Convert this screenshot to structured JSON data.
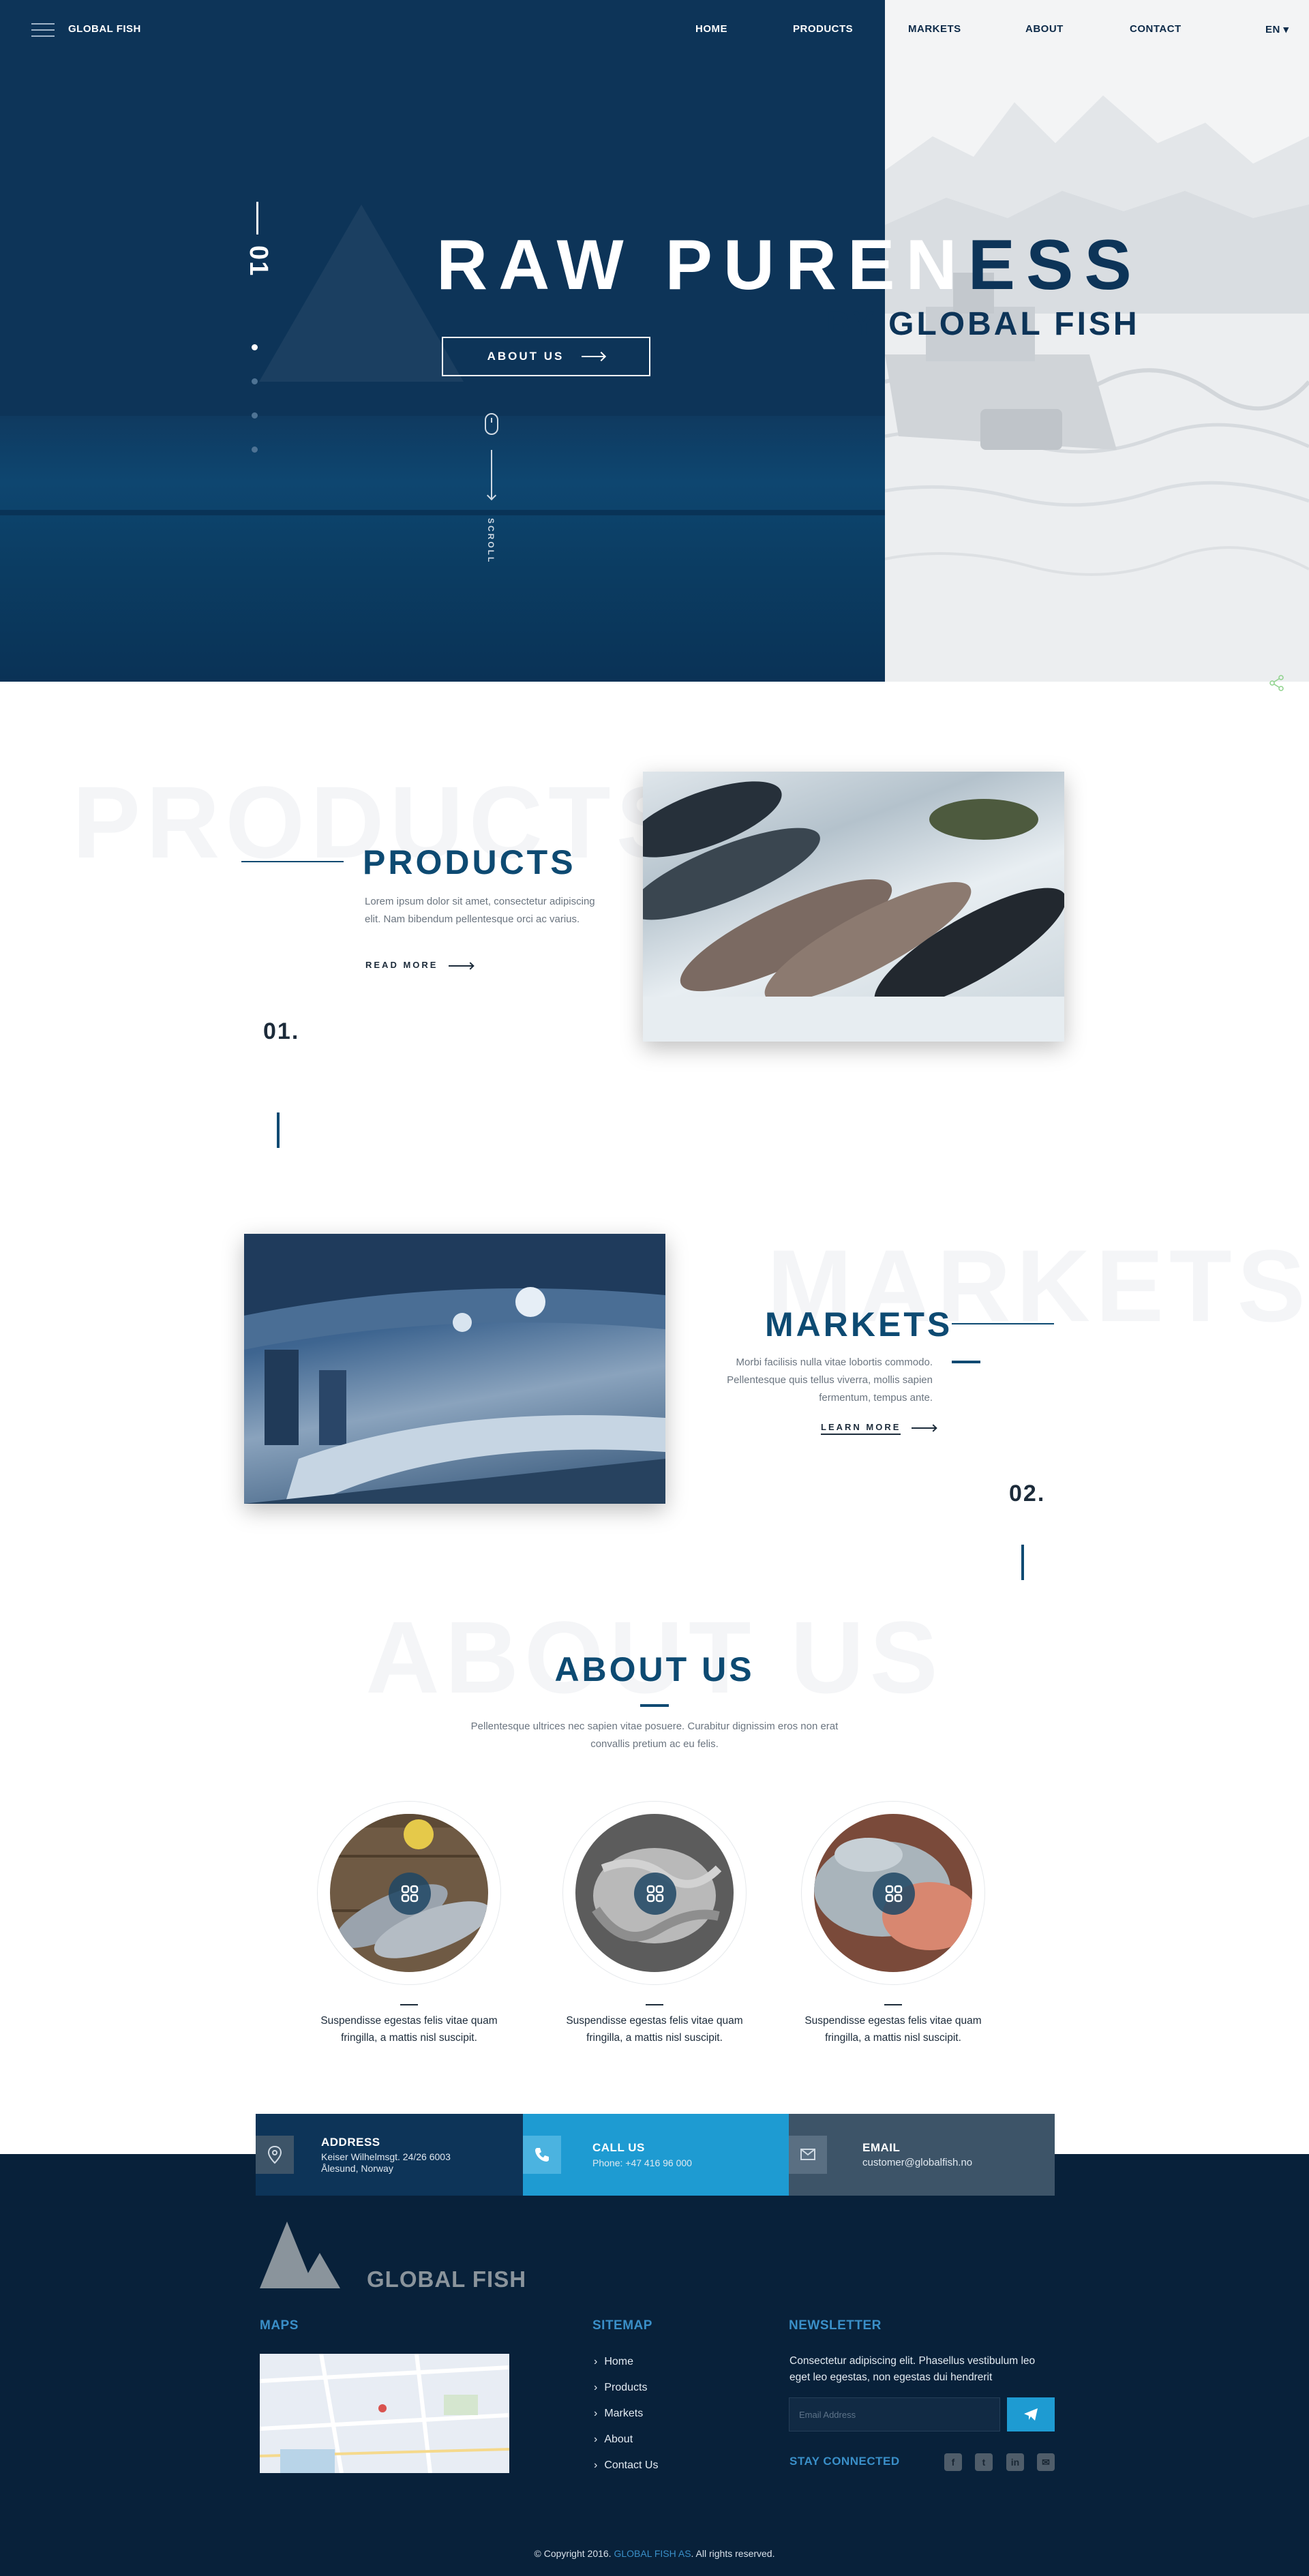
{
  "header": {
    "brand": "GLOBAL FISH",
    "nav": {
      "home": "HOME",
      "products": "PRODUCTS",
      "markets": "MARKETS",
      "about": "ABOUT",
      "contact": "CONTACT"
    },
    "language": "EN ▾"
  },
  "hero": {
    "slide_number": "01",
    "title": "RAW PURENESS",
    "subtitle": "BY GLOBAL FISH",
    "button_label": "ABOUT US",
    "scroll_label": "SCROLL",
    "active_slide": 1,
    "slide_count": 4
  },
  "products": {
    "ghost": "PRODUCTS",
    "title": "PRODUCTS",
    "text": "Lorem ipsum dolor sit amet, consectetur adipiscing elit. Nam bibendum pellentesque orci ac varius.",
    "link": "READ MORE",
    "number": "01."
  },
  "markets": {
    "ghost": "MARKETS",
    "title": "MARKETS",
    "text": "Morbi facilisis nulla vitae lobortis commo­do. Pellentesque quis tellus viverra, mollis sapien fermentum, tempus ante.",
    "link": "LEARN MORE",
    "number": "02."
  },
  "about": {
    "ghost": "ABOUT US",
    "title": "ABOUT US",
    "text": "Pellentesque ultrices nec sapien vitae posuere. Curabitur dignissim eros non erat convallis pretium ac eu felis.",
    "cards": [
      {
        "text": "Suspendisse egestas felis vitae quam fringilla, a mattis nisl suscipit."
      },
      {
        "text": "Suspendisse egestas felis vitae quam fringilla, a mattis nisl suscipit."
      },
      {
        "text": "Suspendisse egestas felis vitae quam fringilla, a mattis nisl suscipit."
      }
    ]
  },
  "contact": {
    "address_label": "ADDRESS",
    "address_line1": "Keiser Wilhelmsgt. 24/26 6003",
    "address_line2": "Ålesund, Norway",
    "call_label": "CALL US",
    "call_value": "Phone: +47 416 96 000",
    "email_label": "EMAIL",
    "email_value": "customer@globalfish.no"
  },
  "footer": {
    "brand": "GLOBAL FISH",
    "maps_heading": "MAPS",
    "sitemap_heading": "SITEMAP",
    "sitemap": [
      "Home",
      "Products",
      "Markets",
      "About",
      "Contact Us"
    ],
    "newsletter_heading": "NEWSLETTER",
    "newsletter_text": "Consectetur adipiscing elit. Phasellus vestibulum leo eget leo egestas, non egestas dui hendrerit",
    "email_placeholder": "Email Address",
    "stay_connected": "STAY CONNECTED",
    "social": [
      "facebook-icon",
      "twitter-icon",
      "linkedin-icon",
      "email-icon"
    ],
    "copyright_pre": "© Copyright 2016.",
    "copyright_brand": "GLOBAL FISH AS",
    "copyright_post": ". All rights reserved."
  },
  "colors": {
    "navy": "#0d3458",
    "footer": "#08213a",
    "accent_blue": "#1e9bd2",
    "heading_blue": "#0d4a72",
    "slate": "#3d5468"
  }
}
